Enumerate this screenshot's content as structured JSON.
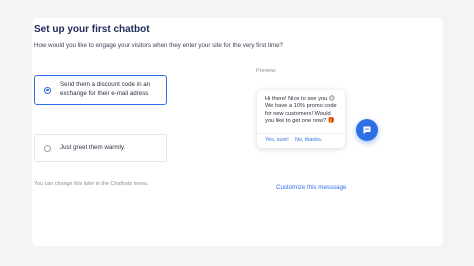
{
  "page": {
    "title": "Set up your first chatbot",
    "subtitle": "How would you like to engage your visitors when they enter your site for the very first time?"
  },
  "options": [
    {
      "label": "Send them a discount code in an exchange for their e-mail adress",
      "selected": true
    },
    {
      "label": "Just greet them warmly.",
      "selected": false
    }
  ],
  "footnote": "You can change this later in the Chatbots menu.",
  "preview": {
    "label": "Preview:",
    "message": "Hi there! Nice to see you 😊 We have a 10% promo code for new customers! Would you like to get one now? 🎁",
    "reply_yes": "Yes, sure!",
    "reply_no": "No, thanks.",
    "chat_button_icon": "chat-bubble-icon",
    "customize_link": "Customize this messsage"
  },
  "colors": {
    "accent": "#2f6fe6",
    "title": "#1d2a59",
    "background": "#f3f4f6"
  }
}
